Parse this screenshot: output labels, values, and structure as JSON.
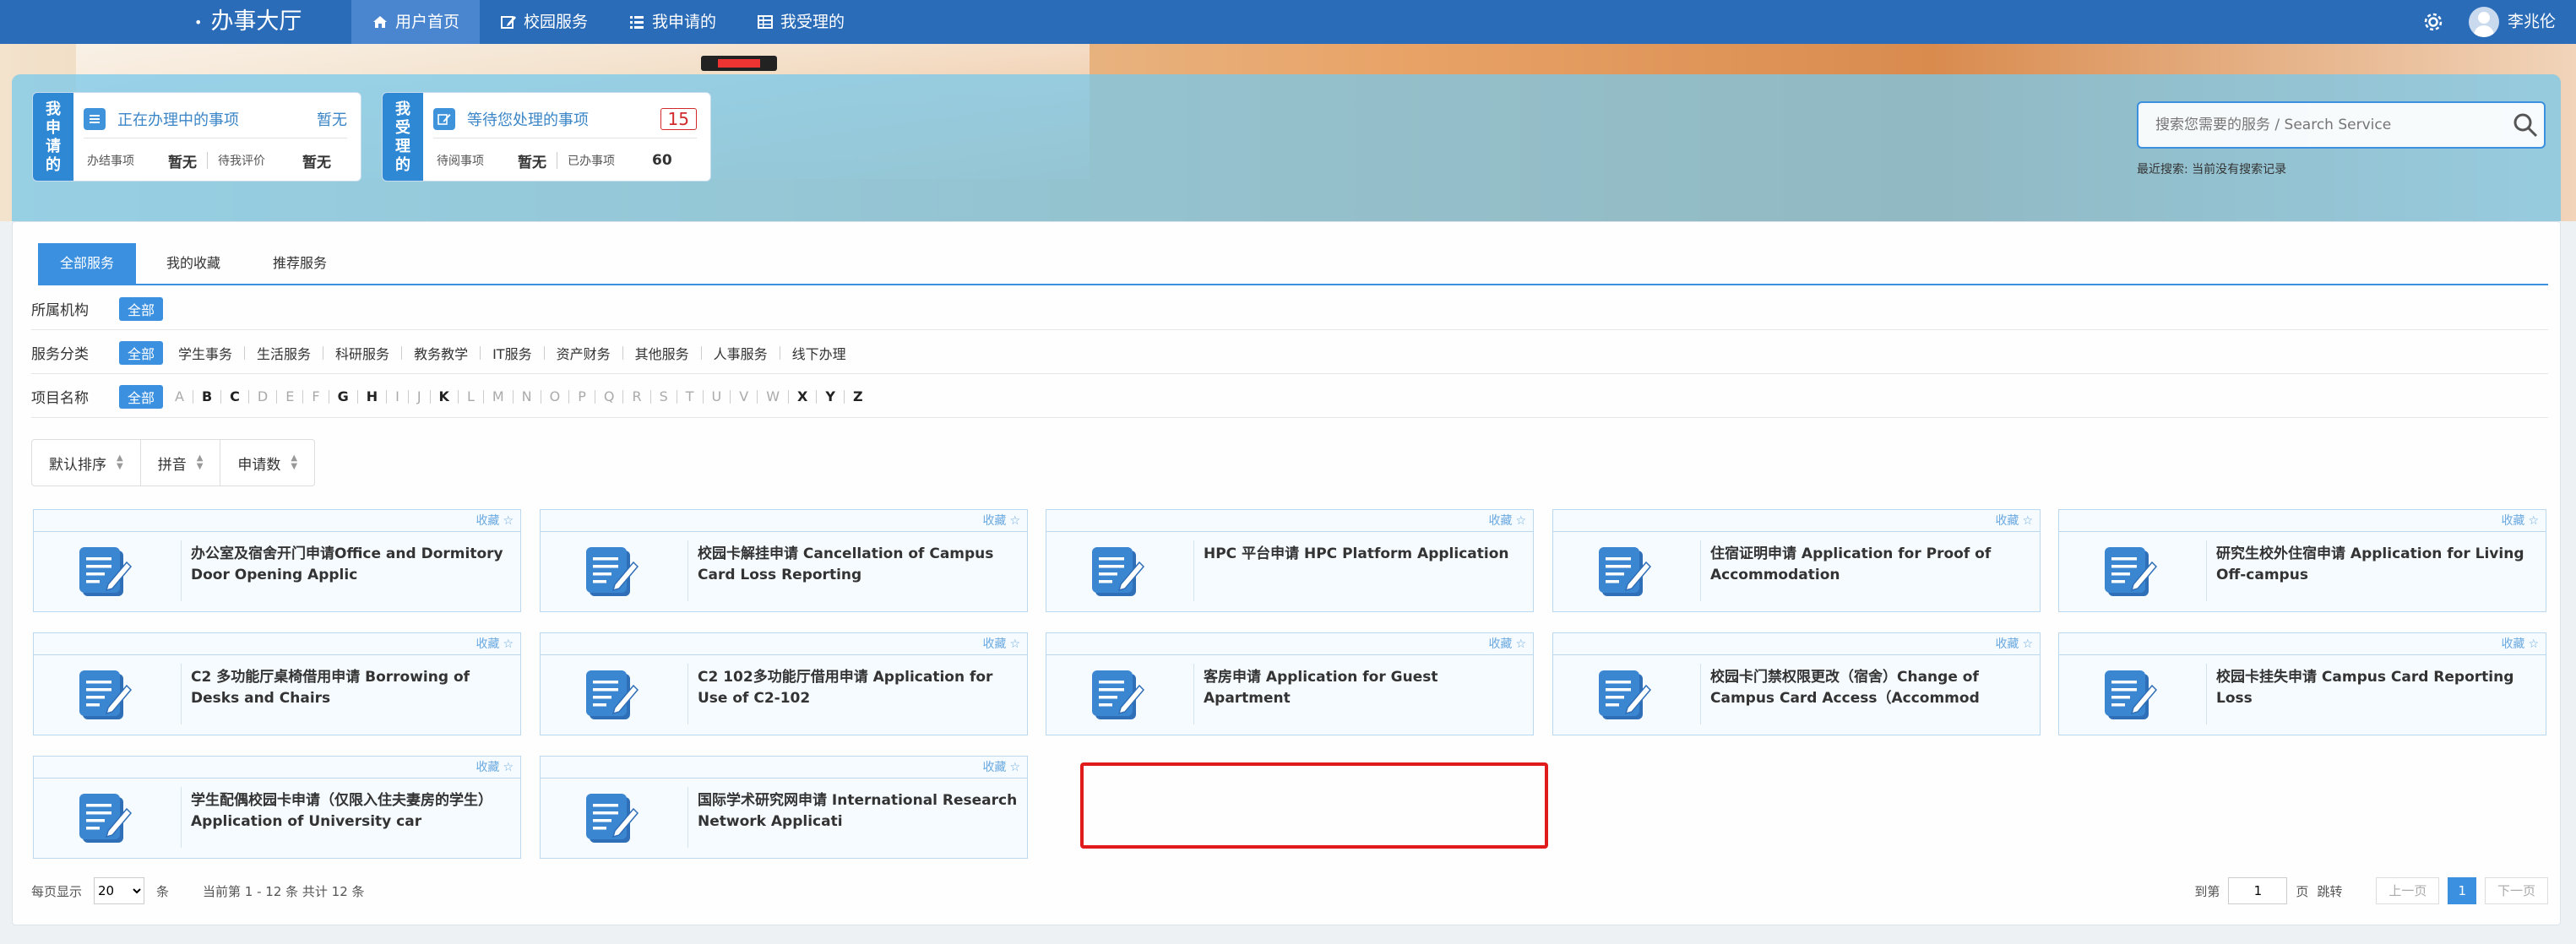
{
  "topbar": {
    "brand": "办事大厅",
    "nav": [
      {
        "label": "用户首页",
        "icon": "home-icon",
        "active": true
      },
      {
        "label": "校园服务",
        "icon": "edit-icon",
        "active": false
      },
      {
        "label": "我申请的",
        "icon": "list-icon",
        "active": false
      },
      {
        "label": "我受理的",
        "icon": "table-icon",
        "active": false
      }
    ],
    "user_name": "李兆伦"
  },
  "summary": {
    "applied": {
      "side": "我申请的",
      "title": "正在办理中的事项",
      "value": "暂无",
      "stats": [
        {
          "label": "办结事项",
          "value": "暂无"
        },
        {
          "label": "待我评价",
          "value": "暂无"
        }
      ]
    },
    "handled": {
      "side": "我受理的",
      "title": "等待您处理的事项",
      "value": "15",
      "stats": [
        {
          "label": "待阅事项",
          "value": "暂无"
        },
        {
          "label": "已办事项",
          "value": "60"
        }
      ]
    }
  },
  "search": {
    "placeholder": "搜索您需要的服务 / Search Service",
    "recent": "最近搜索: 当前没有搜索记录"
  },
  "tabs": [
    "全部服务",
    "我的收藏",
    "推荐服务"
  ],
  "filters": {
    "org": {
      "label": "所属机构",
      "options": [
        "全部"
      ]
    },
    "category": {
      "label": "服务分类",
      "options": [
        "全部",
        "学生事务",
        "生活服务",
        "科研服务",
        "教务教学",
        "IT服务",
        "资产财务",
        "其他服务",
        "人事服务",
        "线下办理"
      ]
    },
    "name": {
      "label": "项目名称",
      "all": "全部",
      "letters": [
        "A",
        "B",
        "C",
        "D",
        "E",
        "F",
        "G",
        "H",
        "I",
        "J",
        "K",
        "L",
        "M",
        "N",
        "O",
        "P",
        "Q",
        "R",
        "S",
        "T",
        "U",
        "V",
        "W",
        "X",
        "Y",
        "Z"
      ],
      "active_letters": [
        "B",
        "C",
        "G",
        "H",
        "K",
        "X",
        "Y",
        "Z"
      ]
    }
  },
  "sort": [
    "默认排序",
    "拼音",
    "申请数"
  ],
  "fav_label": "收藏",
  "cards": [
    "办公室及宿舍开门申请Office and Dormitory Door Opening Applic",
    "校园卡解挂申请 Cancellation of Campus Card Loss Reporting",
    "HPC 平台申请 HPC Platform Application",
    "住宿证明申请 Application for Proof of Accommodation",
    "研究生校外住宿申请 Application for Living Off-campus",
    "C2 多功能厅桌椅借用申请 Borrowing of Desks and Chairs",
    "C2 102多功能厅借用申请 Application for Use of C2-102",
    "客房申请 Application for Guest Apartment",
    "校园卡门禁权限更改（宿舍）Change of Campus Card Access（Accommod",
    "校园卡挂失申请 Campus Card Reporting Loss",
    "学生配偶校园卡申请（仅限入住夫妻房的学生）Application of University car",
    "国际学术研究网申请 International Research Network Applicati"
  ],
  "pager": {
    "per_page_label": "每页显示",
    "per_page": "20",
    "unit": "条",
    "info": "当前第 1 - 12 条 共计 12 条",
    "goto_label": "到第",
    "goto_value": "1",
    "page_unit": "页",
    "jump": "跳转",
    "prev": "上一页",
    "current": "1",
    "next": "下一页"
  },
  "colors": {
    "primary": "#2b6cb8",
    "accent": "#3b90e0",
    "highlight": "#e11b1b"
  }
}
